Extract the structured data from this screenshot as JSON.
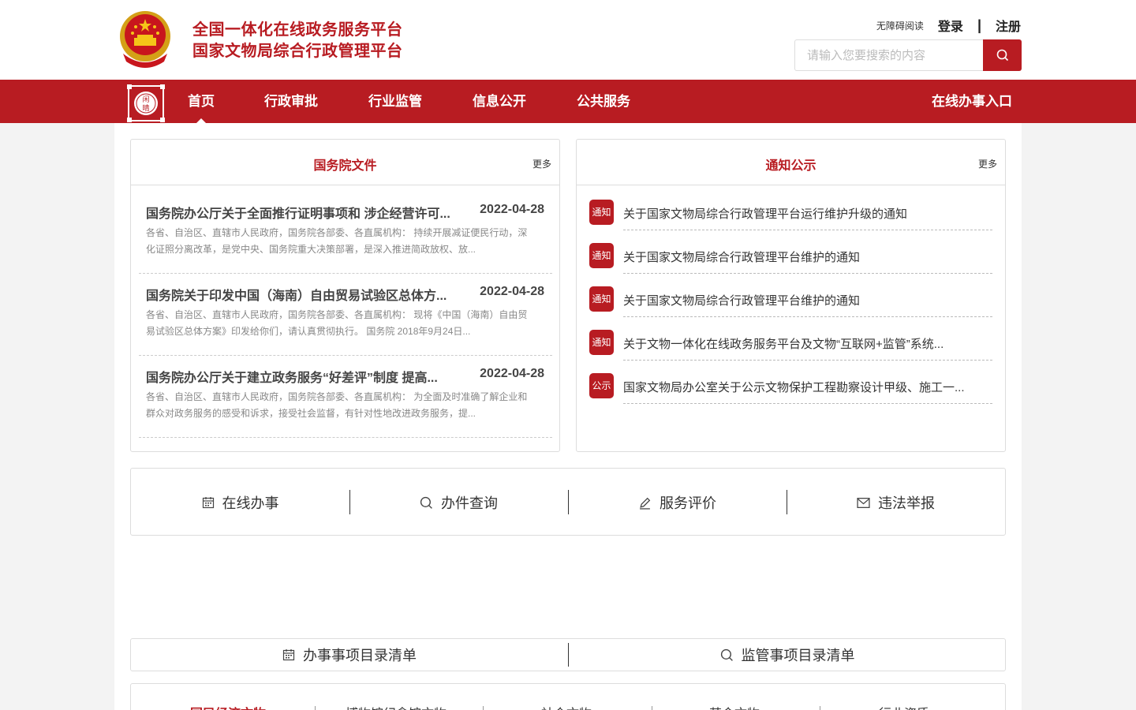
{
  "header": {
    "title_line1": "全国一体化在线政务服务平台",
    "title_line2": "国家文物局综合行政管理平台",
    "accessibility": "无障碍阅读",
    "login": "登录",
    "separator": "|",
    "register": "注册",
    "search_placeholder": "请输入您要搜索的内容"
  },
  "nav": {
    "items": [
      "首页",
      "行政审批",
      "行业监管",
      "信息公开",
      "公共服务"
    ],
    "active": "首页",
    "entry": "在线办事入口",
    "logo_text": "闲晴"
  },
  "state_council": {
    "title": "国务院文件",
    "more": "更多",
    "docs": [
      {
        "title": "国务院办公厅关于全面推行证明事项和 涉企经营许可...",
        "date": "2022-04-28",
        "desc": "各省、自治区、直辖市人民政府，国务院各部委、各直属机构： 持续开展减证便民行动，深化证照分离改革，是党中央、国务院重大决策部署，是深入推进简政放权、放..."
      },
      {
        "title": "国务院关于印发中国（海南）自由贸易试验区总体方...",
        "date": "2022-04-28",
        "desc": "各省、自治区、直辖市人民政府，国务院各部委、各直属机构： 现将《中国（海南）自由贸易试验区总体方案》印发给你们，请认真贯彻执行。 国务院 2018年9月24日..."
      },
      {
        "title": "国务院办公厅关于建立政务服务“好差评”制度 提高...",
        "date": "2022-04-28",
        "desc": "各省、自治区、直辖市人民政府，国务院各部委、各直属机构： 为全面及时准确了解企业和群众对政务服务的感受和诉求，接受社会监督，有针对性地改进政务服务，提..."
      }
    ]
  },
  "notices": {
    "title": "通知公示",
    "more": "更多",
    "items": [
      {
        "badge": "通知",
        "text": "关于国家文物局综合行政管理平台运行维护升级的通知"
      },
      {
        "badge": "通知",
        "text": "关于国家文物局综合行政管理平台维护的通知"
      },
      {
        "badge": "通知",
        "text": "关于国家文物局综合行政管理平台维护的通知"
      },
      {
        "badge": "通知",
        "text": "关于文物一体化在线政务服务平台及文物“互联网+监管”系统..."
      },
      {
        "badge": "公示",
        "text": "国家文物局办公室关于公示文物保护工程勘察设计甲级、施工一..."
      }
    ]
  },
  "services": [
    {
      "label": "在线办事",
      "icon": "calendar-icon"
    },
    {
      "label": "办件查询",
      "icon": "search-icon"
    },
    {
      "label": "服务评价",
      "icon": "pen-icon"
    },
    {
      "label": "违法举报",
      "icon": "mail-icon"
    }
  ],
  "catalog": [
    {
      "label": "办事事项目录清单",
      "icon": "calendar-icon"
    },
    {
      "label": "监管事项目录清单",
      "icon": "search-icon"
    }
  ],
  "bottom_tabs": [
    "国民经济文物",
    "博物馆纪念馆文物",
    "社会文物",
    "革命文物",
    "行业资质"
  ],
  "colors": {
    "brand": "#b81c22"
  }
}
